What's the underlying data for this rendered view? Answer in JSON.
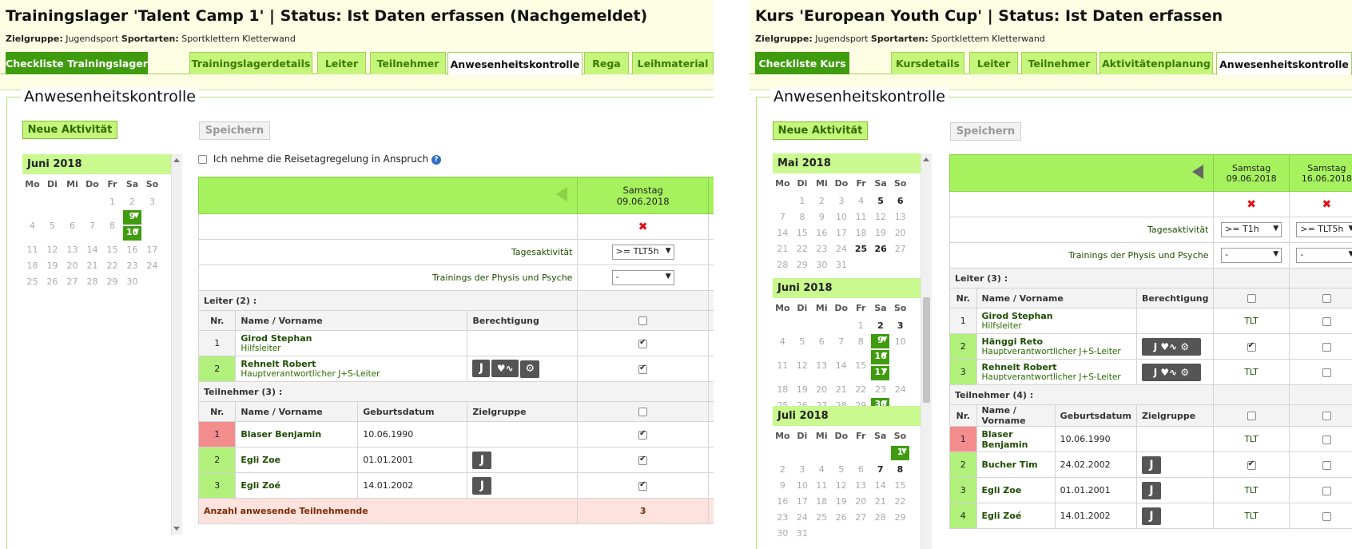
{
  "left": {
    "title": "Trainingslager 'Talent Camp 1' | Status: Ist Daten erfassen (Nachgemeldet)",
    "zielgruppe_label": "Zielgruppe:",
    "zielgruppe": "Jugendsport",
    "sportarten_label": "Sportarten:",
    "sportarten": "Sportklettern Kletterwand",
    "tabs": [
      "Checkliste Trainingslager",
      "Trainingslagerdetails",
      "Leiter",
      "Teilnehmer",
      "Anwesenheitskontrolle",
      "Rega",
      "Leihmaterial"
    ],
    "legend": "Anwesenheitskontrolle",
    "new_activity": "Neue Aktivität",
    "save": "Speichern",
    "reise_check": "Ich nehme die Reisetagregelung in Anspruch",
    "help_icon": "?",
    "calendar": {
      "month": "Juni 2018",
      "weekdays": [
        "Mo",
        "Di",
        "Mi",
        "Do",
        "Fr",
        "Sa",
        "So"
      ]
    },
    "date_head": {
      "day": "Samstag",
      "date": "09.06.2018"
    },
    "tagesaktivitaet_label": "Tagesaktivität",
    "tagesaktivitaet_value": ">= TLT5h",
    "physis_label": "Trainings der Physis und Psyche",
    "physis_value": "-",
    "leiter_section": "Leiter (2) :",
    "cols_leiter": [
      "Nr.",
      "Name / Vorname",
      "Berechtigung"
    ],
    "leiter": [
      {
        "nr": "1",
        "name": "Girod Stephan",
        "role": "Hilfsleiter"
      },
      {
        "nr": "2",
        "name": "Rehnelt Robert",
        "role": "Hauptverantwortlicher J+S-Leiter"
      }
    ],
    "tn_section": "Teilnehmer (3) :",
    "cols_tn": [
      "Nr.",
      "Name / Vorname",
      "Geburtsdatum",
      "Zielgruppe"
    ],
    "teilnehmer": [
      {
        "nr": "1",
        "name": "Blaser Benjamin",
        "geb": "10.06.1990"
      },
      {
        "nr": "2",
        "name": "Egli Zoe",
        "geb": "01.01.2001",
        "zg": "J"
      },
      {
        "nr": "3",
        "name": "Egli Zoé",
        "geb": "14.01.2002",
        "zg": "J"
      }
    ],
    "sum_label": "Anzahl anwesende Teilnehmende",
    "sum_value": "3",
    "j_icon": "J",
    "x_mark": "✖"
  },
  "right": {
    "title": "Kurs 'European Youth Cup' | Status: Ist Daten erfassen",
    "zielgruppe_label": "Zielgruppe:",
    "zielgruppe": "Jugendsport",
    "sportarten_label": "Sportarten:",
    "sportarten": "Sportklettern Kletterwand",
    "tabs": [
      "Checkliste Kurs",
      "Kursdetails",
      "Leiter",
      "Teilnehmer",
      "Aktivitätenplanung",
      "Anwesenheitskontrolle"
    ],
    "legend": "Anwesenheitskontrolle",
    "new_activity": "Neue Aktivität",
    "save": "Speichern",
    "calendars": [
      {
        "month": "Mai 2018"
      },
      {
        "month": "Juni 2018"
      },
      {
        "month": "Juli 2018"
      }
    ],
    "weekdays": [
      "Mo",
      "Di",
      "Mi",
      "Do",
      "Fr",
      "Sa",
      "So"
    ],
    "date_heads": [
      {
        "day": "Samstag",
        "date": "09.06.2018"
      },
      {
        "day": "Samstag",
        "date": "16.06.2018"
      }
    ],
    "tagesaktivitaet_label": "Tagesaktivität",
    "tagesaktivitaet_values": [
      ">= T1h",
      ">= TLT5h"
    ],
    "physis_label": "Trainings der Physis und Psyche",
    "physis_values": [
      "-",
      "-"
    ],
    "leiter_section": "Leiter (3) :",
    "cols_leiter": [
      "Nr.",
      "Name / Vorname",
      "Berechtigung"
    ],
    "leiter": [
      {
        "nr": "1",
        "name": "Girod Stephan",
        "role": "Hilfsleiter",
        "c1": "TLT"
      },
      {
        "nr": "2",
        "name": "Hänggi Reto",
        "role": "Hauptverantwortlicher J+S-Leiter"
      },
      {
        "nr": "3",
        "name": "Rehnelt Robert",
        "role": "Hauptverantwortlicher J+S-Leiter",
        "c1": "TLT"
      }
    ],
    "tn_section": "Teilnehmer (4) :",
    "cols_tn": [
      "Nr.",
      "Name / Vorname",
      "Geburtsdatum",
      "Zielgruppe"
    ],
    "teilnehmer": [
      {
        "nr": "1",
        "name": "Blaser Benjamin",
        "geb": "10.06.1990",
        "c1": "TLT"
      },
      {
        "nr": "2",
        "name": "Bucher Tim",
        "geb": "24.02.2002",
        "zg": "J"
      },
      {
        "nr": "3",
        "name": "Egli Zoe",
        "geb": "01.01.2001",
        "zg": "J",
        "c1": "TLT"
      },
      {
        "nr": "4",
        "name": "Egli Zoé",
        "geb": "14.01.2002",
        "zg": "J",
        "c1": "TLT"
      }
    ],
    "j_icon": "J",
    "x_mark": "✖"
  }
}
